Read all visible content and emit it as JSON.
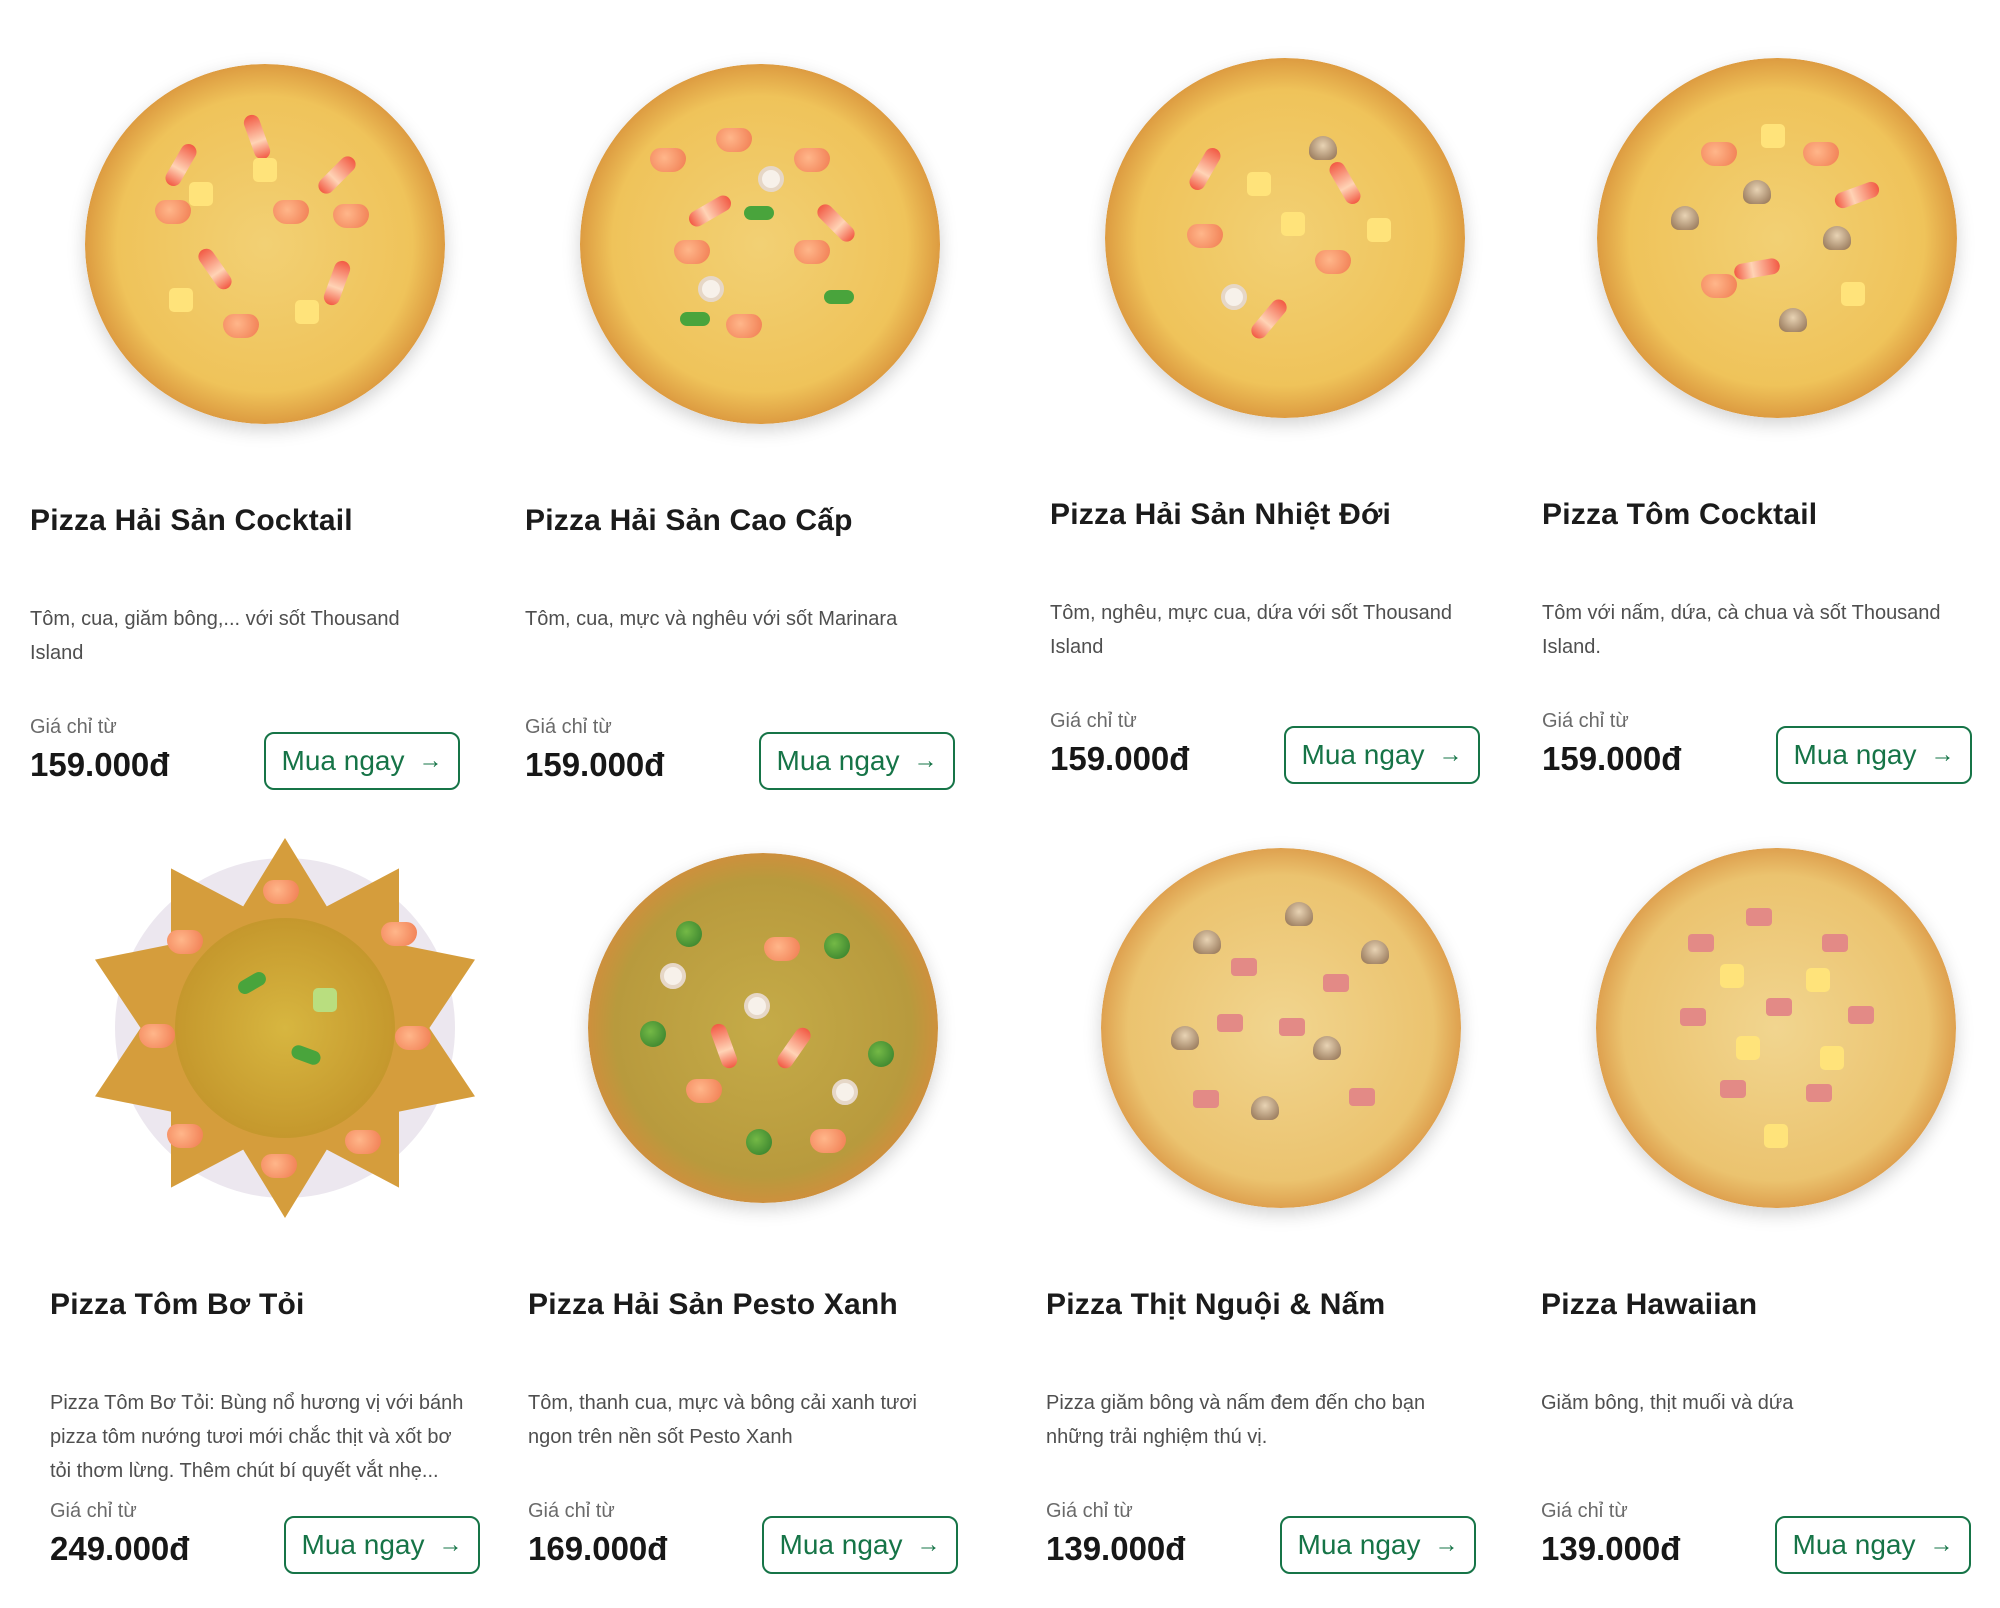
{
  "products": [
    {
      "name": "Pizza Hải Sản Cocktail",
      "description": "Tôm, cua, giăm bông,... với sốt Thousand Island",
      "price_label": "Giá chỉ từ",
      "price": "159.000đ",
      "button_label": "Mua ngay"
    },
    {
      "name": "Pizza Hải Sản Cao Cấp",
      "description": "Tôm, cua, mực và nghêu với sốt Marinara",
      "price_label": "Giá chỉ từ",
      "price": "159.000đ",
      "button_label": "Mua ngay"
    },
    {
      "name": "Pizza Hải Sản Nhiệt Đới",
      "description": "Tôm, nghêu, mực cua, dứa với sốt Thousand Island",
      "price_label": "Giá chỉ từ",
      "price": "159.000đ",
      "button_label": "Mua ngay"
    },
    {
      "name": "Pizza Tôm Cocktail",
      "description": "Tôm với nấm, dứa, cà chua và sốt Thousand Island.",
      "price_label": "Giá chỉ từ",
      "price": "159.000đ",
      "button_label": "Mua ngay"
    },
    {
      "name": "Pizza Tôm Bơ Tỏi",
      "description": "Pizza Tôm Bơ Tỏi: Bùng nổ hương vị với bánh pizza tôm nướng tươi mới chắc thịt và xốt bơ tỏi thơm lừng. Thêm chút bí quyết vắt nhẹ...",
      "price_label": "Giá chỉ từ",
      "price": "249.000đ",
      "button_label": "Mua ngay"
    },
    {
      "name": "Pizza Hải Sản Pesto Xanh",
      "description": "Tôm, thanh cua, mực và bông cải xanh tươi ngon trên nền sốt Pesto Xanh",
      "price_label": "Giá chỉ từ",
      "price": "169.000đ",
      "button_label": "Mua ngay"
    },
    {
      "name": "Pizza Thịt Nguội & Nấm",
      "description": "Pizza giăm bông và nấm đem đến cho bạn những trải nghiệm thú vị.",
      "price_label": "Giá chỉ từ",
      "price": "139.000đ",
      "button_label": "Mua ngay"
    },
    {
      "name": "Pizza Hawaiian",
      "description": "Giăm bông, thịt muối và dứa",
      "price_label": "Giá chỉ từ",
      "price": "139.000đ",
      "button_label": "Mua ngay"
    }
  ],
  "colors": {
    "accent": "#167447",
    "text": "#1b1b1b",
    "muted": "#6a6a6a"
  },
  "icons": {
    "buy_arrow": "arrow-right-icon"
  }
}
